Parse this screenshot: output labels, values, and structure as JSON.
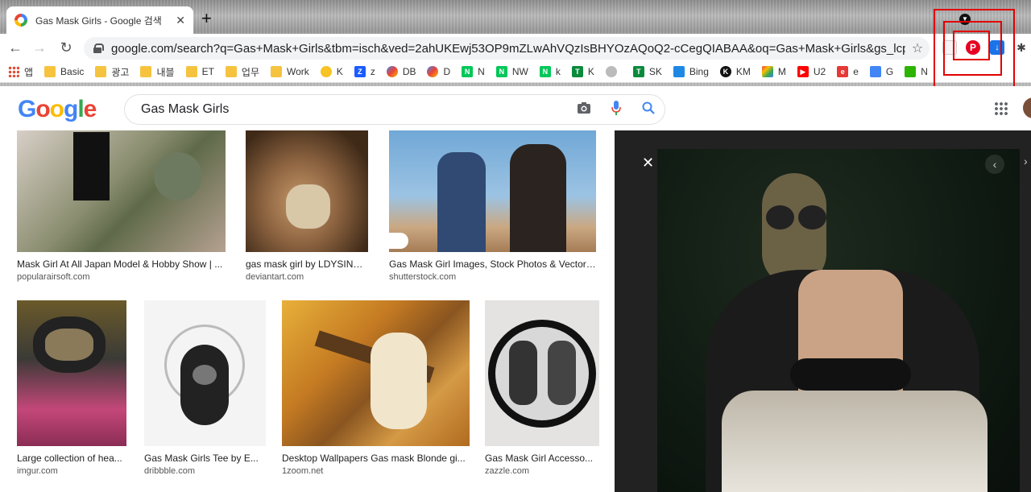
{
  "browser": {
    "tab_title": "Gas Mask Girls - Google 검색",
    "new_tab": "+",
    "url": "google.com/search?q=Gas+Mask+Girls&tbm=isch&ved=2ahUKEwj53OP9mZLwAhVQzIsBHYOzAQoQ2-cCegQIABAA&oq=Gas+Mask+Girls&gs_lcp=CgNpb..."
  },
  "bookmarks": [
    {
      "label": "앱",
      "icon": "apps-icon"
    },
    {
      "label": "Basic",
      "icon": "folder-icon"
    },
    {
      "label": "광고",
      "icon": "folder-icon"
    },
    {
      "label": "내블",
      "icon": "folder-icon"
    },
    {
      "label": "ET",
      "icon": "folder-icon"
    },
    {
      "label": "업무",
      "icon": "folder-icon"
    },
    {
      "label": "Work",
      "icon": "folder-icon"
    },
    {
      "label": "K",
      "icon": "bulb-icon"
    },
    {
      "label": "z",
      "icon": "z-icon"
    },
    {
      "label": "DB",
      "icon": "d-icon"
    },
    {
      "label": "D",
      "icon": "d-icon"
    },
    {
      "label": "N",
      "icon": "naver-icon"
    },
    {
      "label": "NW",
      "icon": "naver-icon"
    },
    {
      "label": "k",
      "icon": "naver-icon"
    },
    {
      "label": "K",
      "icon": "t-icon"
    },
    {
      "label": "",
      "icon": "globe-icon"
    },
    {
      "label": "SK",
      "icon": "t-icon"
    },
    {
      "label": "Bing",
      "icon": "bing-icon"
    },
    {
      "label": "KM",
      "icon": "k-icon"
    },
    {
      "label": "M",
      "icon": "gmail-icon"
    },
    {
      "label": "U2",
      "icon": "youtube-icon"
    },
    {
      "label": "e",
      "icon": "e-icon"
    },
    {
      "label": "G",
      "icon": "translate-icon"
    },
    {
      "label": "N",
      "icon": "n-icon"
    }
  ],
  "search": {
    "logo": "Google",
    "query": "Gas Mask Girls"
  },
  "results": [
    {
      "title": "Mask Girl At All Japan Model & Hobby Show | ...",
      "source": "popularairsoft.com"
    },
    {
      "title": "gas mask girl by LDYSINZ ...",
      "source": "deviantart.com"
    },
    {
      "title": "Gas Mask Girl Images, Stock Photos & Vectors...",
      "source": "shutterstock.com"
    },
    {
      "title": "Large collection of hea...",
      "source": "imgur.com"
    },
    {
      "title": "Gas Mask Girls Tee by E...",
      "source": "dribbble.com"
    },
    {
      "title": "Desktop Wallpapers Gas mask Blonde gi...",
      "source": "1zoom.net"
    },
    {
      "title": "Gas Mask Girl Accesso...",
      "source": "zazzle.com"
    }
  ],
  "viewer": {
    "close": "✕",
    "prev": "‹",
    "next": "›"
  },
  "colors": {
    "highlight_box": "#e20000",
    "pinterest": "#e60023"
  }
}
